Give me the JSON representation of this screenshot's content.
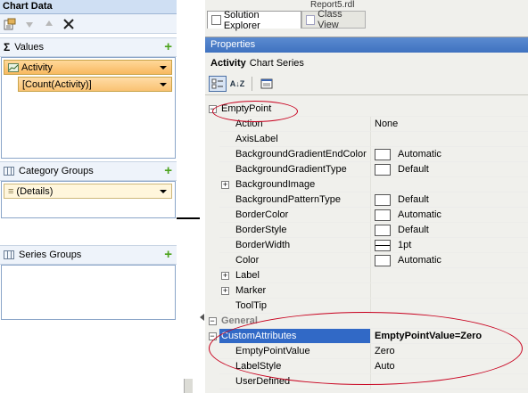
{
  "chart_data_panel": {
    "title": "Chart Data",
    "toolbar": {
      "icons": [
        "properties-icon",
        "move-down-icon",
        "move-up-icon",
        "delete-icon"
      ]
    },
    "values": {
      "header_symbol": "Σ",
      "header": "Values",
      "items": [
        {
          "label": "Activity"
        },
        {
          "label": "[Count(Activity)]"
        }
      ]
    },
    "category_groups": {
      "header": "Category Groups",
      "items": [
        {
          "label": "(Details)",
          "prefix": "≡"
        }
      ]
    },
    "series_groups": {
      "header": "Series Groups"
    }
  },
  "solution_explorer": {
    "tabs": [
      {
        "label": "Solution Explorer"
      },
      {
        "label": "Class View"
      }
    ],
    "file_tab": "Report5.rdl"
  },
  "properties": {
    "title": "Properties",
    "object_name": "Activity",
    "object_type": "Chart Series",
    "sort_alpha_label": "A↓Z",
    "rows": [
      {
        "kind": "cat",
        "expander": "−",
        "name": "EmptyPoint",
        "value": ""
      },
      {
        "kind": "prop",
        "name": "Action",
        "value": "None"
      },
      {
        "kind": "prop",
        "name": "AxisLabel",
        "value": ""
      },
      {
        "kind": "prop",
        "name": "BackgroundGradientEndColor",
        "value": "Automatic",
        "swatch": "plain"
      },
      {
        "kind": "prop",
        "name": "BackgroundGradientType",
        "value": "Default",
        "swatch": "plain"
      },
      {
        "kind": "prop",
        "name": "BackgroundImage",
        "value": "",
        "expander": "+"
      },
      {
        "kind": "prop",
        "name": "BackgroundPatternType",
        "value": "Default",
        "swatch": "plain"
      },
      {
        "kind": "prop",
        "name": "BorderColor",
        "value": "Automatic",
        "swatch": "plain"
      },
      {
        "kind": "prop",
        "name": "BorderStyle",
        "value": "Default",
        "swatch": "plain"
      },
      {
        "kind": "prop",
        "name": "BorderWidth",
        "value": "1pt",
        "swatch": "lined"
      },
      {
        "kind": "prop",
        "name": "Color",
        "value": "Automatic",
        "swatch": "plain"
      },
      {
        "kind": "prop",
        "name": "Label",
        "value": "",
        "expander": "+"
      },
      {
        "kind": "prop",
        "name": "Marker",
        "value": "",
        "expander": "+"
      },
      {
        "kind": "prop",
        "name": "ToolTip",
        "value": ""
      },
      {
        "kind": "cat",
        "expander": "−",
        "name": "General",
        "value": ""
      },
      {
        "kind": "selected",
        "expander": "−",
        "name": "CustomAttributes",
        "value": "EmptyPointValue=Zero"
      },
      {
        "kind": "prop",
        "name": "EmptyPointValue",
        "value": "Zero"
      },
      {
        "kind": "prop",
        "name": "LabelStyle",
        "value": "Auto"
      },
      {
        "kind": "prop",
        "name": "UserDefined",
        "value": ""
      }
    ]
  },
  "colors": {
    "accent": "#3169c6",
    "annotation": "#c8001e",
    "title_bar": "#4a7cc8"
  }
}
